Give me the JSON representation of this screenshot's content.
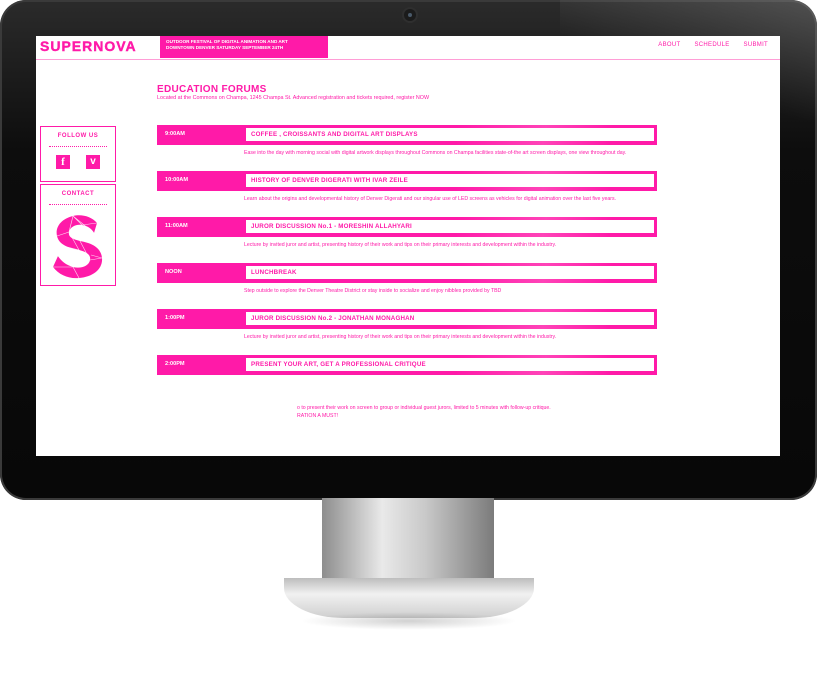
{
  "site": {
    "logo": "SUPERNOVA",
    "tagline_line1": "OUTDOOR FESTIVAL OF DIGITAL ANIMATION AND ART",
    "tagline_line2": "DOWNTOWN DENVER SATURDAY SEPTEMBER 24TH",
    "nav": [
      "ABOUT",
      "SCHEDULE",
      "SUBMIT"
    ]
  },
  "sidebar": {
    "follow_title": "FOLLOW US",
    "social_icons": [
      "facebook-icon",
      "vimeo-icon"
    ],
    "contact_title": "CONTACT"
  },
  "page": {
    "title": "EDUCATION FORUMS",
    "subtitle": "Located at the Commons on Champa, 1245 Champa St. Advanced registration and tickets required, register NOW"
  },
  "schedule": [
    {
      "time": "9:00AM",
      "event": "COFFEE , CROISSANTS AND DIGITAL ART DISPLAYS",
      "desc": "Ease into the day with morning social with digital artwork displays throughout Commons on Champa facilities state-of-the art screen displays, one view throughout day."
    },
    {
      "time": "10:00AM",
      "event": "HISTORY OF DENVER DIGERATI WITH IVAR ZEILE",
      "desc": "Learn about the origins and developmental history of Denver Digerati and our singular use of LED screens as vehicles for digital animation over the last five years."
    },
    {
      "time": "11:00AM",
      "event": "JUROR DISCUSSION No.1 - MORESHIN ALLAHYARI",
      "desc": "Lecture by invited juror and artist, presenting history of their work and tips on their primary interests and development within the industry."
    },
    {
      "time": "NOON",
      "event": "LUNCHBREAK",
      "desc": "Step outside to explore the Denver Theatre District or stay inside to socialize and enjoy nibbles provided by TBD"
    },
    {
      "time": "1:00PM",
      "event": "JUROR DISCUSSION No.2 - JONATHAN MONAGHAN",
      "desc": "Lecture by invited juror and artist, presenting history of their work and tips on their primary interests and development within the industry."
    },
    {
      "time": "2:00PM",
      "event": "PRESENT YOUR ART, GET A PROFESSIONAL CRITIQUE",
      "desc": ""
    }
  ],
  "last_desc_line1": "o to present their work on screen to group or individual guest jurors, limited to 5 minutes with follow-up critique.",
  "last_desc_line2": "RATION A MUST!",
  "colors": {
    "accent": "#ff1aa8",
    "bezel": "#0d0d0d"
  }
}
